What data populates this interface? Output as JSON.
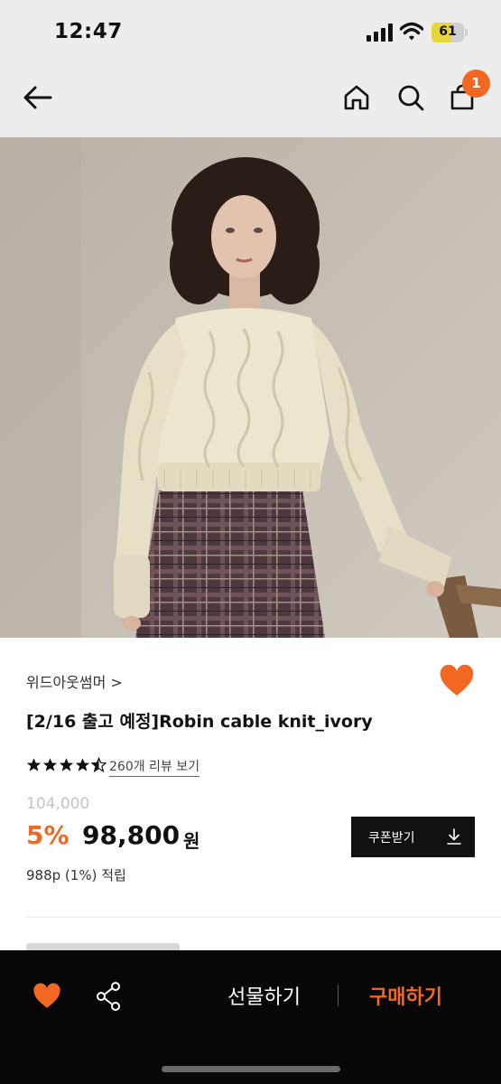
{
  "status_bar": {
    "time": "12:47",
    "battery": "61",
    "battery_level": 0.61,
    "battery_color": "#e8d53a"
  },
  "nav": {
    "cart_count": "1"
  },
  "product": {
    "brand": "위드아웃썸머 >",
    "title": "[2/16 출고 예정]Robin cable knit_ivory",
    "rating": 4.5,
    "reviews_link": "260개 리뷰 보기",
    "original_price": "104,000",
    "discount": "5%",
    "price": "98,800",
    "currency": "원",
    "points": "988p (1%) 적립",
    "coupon_label": "쿠폰받기",
    "liked": true
  },
  "bottom_bar": {
    "gift_label": "선물하기",
    "buy_label": "구매하기"
  },
  "colors": {
    "accent": "#f26822",
    "dark": "#070707"
  },
  "icons": [
    "back-arrow-icon",
    "home-icon",
    "search-icon",
    "shopping-bag-icon",
    "heart-icon",
    "share-icon",
    "download-icon",
    "star-icon"
  ]
}
